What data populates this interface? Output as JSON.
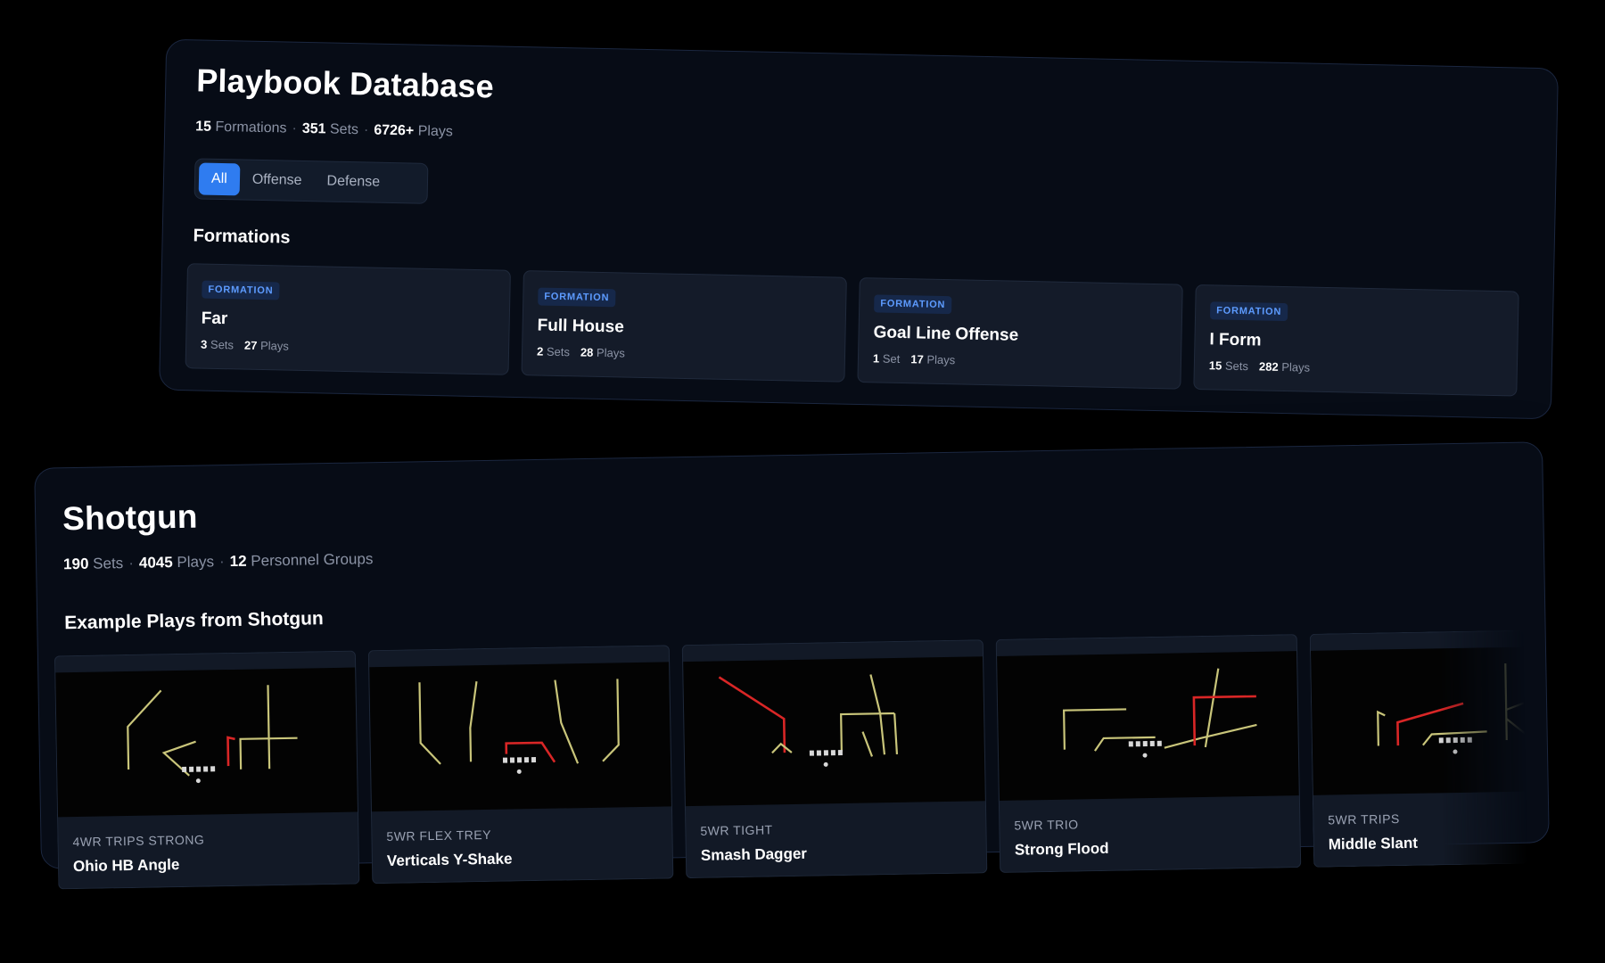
{
  "database": {
    "title": "Playbook Database",
    "stats": [
      {
        "value": "15",
        "label": "Formations"
      },
      {
        "value": "351",
        "label": "Sets"
      },
      {
        "value": "6726+",
        "label": "Plays"
      }
    ],
    "filters": [
      "All",
      "Offense",
      "Defense"
    ],
    "active_filter": "All",
    "section_title": "Formations",
    "formations": [
      {
        "badge": "FORMATION",
        "name": "Far",
        "sets_value": "3",
        "sets_label": "Sets",
        "plays_value": "27",
        "plays_label": "Plays"
      },
      {
        "badge": "FORMATION",
        "name": "Full House",
        "sets_value": "2",
        "sets_label": "Sets",
        "plays_value": "28",
        "plays_label": "Plays"
      },
      {
        "badge": "FORMATION",
        "name": "Goal Line Offense",
        "sets_value": "1",
        "sets_label": "Set",
        "plays_value": "17",
        "plays_label": "Plays"
      },
      {
        "badge": "FORMATION",
        "name": "I Form",
        "sets_value": "15",
        "sets_label": "Sets",
        "plays_value": "282",
        "plays_label": "Plays"
      }
    ]
  },
  "shotgun": {
    "title": "Shotgun",
    "stats": [
      {
        "value": "190",
        "label": "Sets"
      },
      {
        "value": "4045",
        "label": "Plays"
      },
      {
        "value": "12",
        "label": "Personnel Groups"
      }
    ],
    "section_title": "Example Plays from Shotgun",
    "plays": [
      {
        "formation": "4WR TRIPS STRONG",
        "name": "Ohio HB Angle"
      },
      {
        "formation": "5WR FLEX TREY",
        "name": "Verticals Y-Shake"
      },
      {
        "formation": "5WR TIGHT",
        "name": "Smash Dagger"
      },
      {
        "formation": "5WR TRIO",
        "name": "Strong Flood"
      },
      {
        "formation": "5WR TRIPS",
        "name": "Middle Slant"
      }
    ]
  },
  "colors": {
    "accent": "#2f7cf0",
    "route_primary": "#c9c57a",
    "route_highlight": "#d92626",
    "player_marker": "#d8d8d8"
  }
}
